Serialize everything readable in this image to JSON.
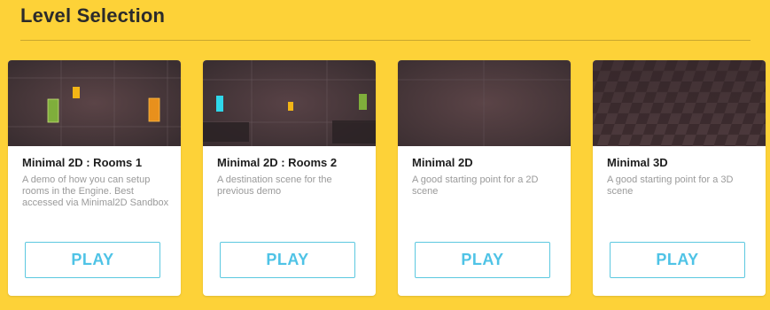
{
  "page": {
    "title": "Level Selection"
  },
  "levels": [
    {
      "title": "Minimal 2D : Rooms 1",
      "description": "A demo of how you can setup rooms in the Engine. Best accessed via Minimal2D Sandbox",
      "play_label": "PLAY",
      "thumbnail": "rooms1-scene-preview"
    },
    {
      "title": "Minimal 2D : Rooms 2",
      "description": "A destination scene for the previous demo",
      "play_label": "PLAY",
      "thumbnail": "rooms2-scene-preview"
    },
    {
      "title": "Minimal 2D",
      "description": "A good starting point for a 2D scene",
      "play_label": "PLAY",
      "thumbnail": "minimal2d-scene-preview"
    },
    {
      "title": "Minimal 3D",
      "description": "A good starting point for a 3D scene",
      "play_label": "PLAY",
      "thumbnail": "minimal3d-scene-preview"
    }
  ],
  "colors": {
    "background": "#FDD238",
    "card": "#FFFFFF",
    "accent": "#4FC3E6",
    "title_text": "#1E1E1E",
    "desc_text": "#9A9A9A"
  }
}
